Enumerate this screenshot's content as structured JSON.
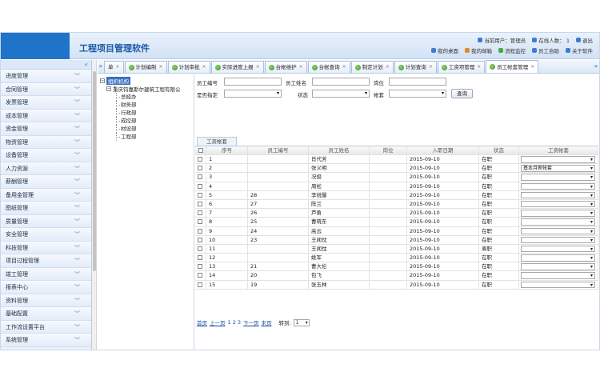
{
  "app": {
    "title": "工程项目管理软件"
  },
  "header": {
    "current_user_label": "当前用户：管理员",
    "online_label": "在线人数： 1",
    "logout": "退出",
    "links": [
      "我的桌面",
      "我的邮箱",
      "流程监控",
      "员工自助",
      "关于软件"
    ]
  },
  "sidebar": {
    "collapse_glyph": "«",
    "items": [
      "进度管理",
      "合同管理",
      "发票管理",
      "成本管理",
      "资金管理",
      "物资管理",
      "设备管理",
      "人力资源",
      "薪酬管理",
      "备用金管理",
      "图纸管理",
      "质量管理",
      "安全管理",
      "科技管理",
      "项目过程管理",
      "竣工管理",
      "报表中心",
      "资料管理",
      "基础配置",
      "工作流设置平台",
      "系统管理"
    ]
  },
  "tabs": {
    "prev_glyph": "«",
    "next_glyph": "»",
    "items": [
      {
        "label": "单"
      },
      {
        "label": "计划编制"
      },
      {
        "label": "计划审批"
      },
      {
        "label": "实际进度上报"
      },
      {
        "label": "台帐维护"
      },
      {
        "label": "台帐查询"
      },
      {
        "label": "制定计划"
      },
      {
        "label": "计划查询"
      },
      {
        "label": "工资项管理"
      },
      {
        "label": "员工帐套管理"
      }
    ],
    "active_index": 9,
    "close_glyph": "×"
  },
  "tree": {
    "root": "组织机构",
    "company": "重庆钧嘉斯尔建筑工程有限公",
    "departments": [
      "总经办",
      "财务部",
      "行政部",
      "成控部",
      "材设部",
      "工程部"
    ]
  },
  "filters": {
    "emp_no_label": "员工编号",
    "emp_name_label": "员工姓名",
    "position_label": "岗位",
    "assigned_label": "是否指定",
    "status_label": "状态",
    "account_label": "帐套",
    "query_button": "查询"
  },
  "subtab": "工资帐套",
  "table": {
    "headers": [
      "",
      "序号",
      "员工编号",
      "员工姓名",
      "岗位",
      "入职日期",
      "状态",
      "工资帐套"
    ],
    "rows": [
      {
        "seq": "1",
        "no": "",
        "name": "肖代芳",
        "pos": "",
        "date": "2015-09-10",
        "status": "在职",
        "account": ""
      },
      {
        "seq": "2",
        "no": "",
        "name": "张义明",
        "pos": "",
        "date": "2015-09-10",
        "status": "在职",
        "account": "基本月薪帐套"
      },
      {
        "seq": "3",
        "no": "",
        "name": "况俊",
        "pos": "",
        "date": "2015-09-10",
        "status": "在职",
        "account": ""
      },
      {
        "seq": "4",
        "no": "",
        "name": "周松",
        "pos": "",
        "date": "2015-09-10",
        "status": "在职",
        "account": ""
      },
      {
        "seq": "5",
        "no": "28",
        "name": "李锐馨",
        "pos": "",
        "date": "2015-09-10",
        "status": "在职",
        "account": ""
      },
      {
        "seq": "6",
        "no": "27",
        "name": "陈兰",
        "pos": "",
        "date": "2015-09-10",
        "status": "在职",
        "account": ""
      },
      {
        "seq": "7",
        "no": "26",
        "name": "芦勇",
        "pos": "",
        "date": "2015-09-10",
        "status": "在职",
        "account": ""
      },
      {
        "seq": "8",
        "no": "25",
        "name": "曹晓东",
        "pos": "",
        "date": "2015-09-10",
        "status": "在职",
        "account": ""
      },
      {
        "seq": "9",
        "no": "24",
        "name": "高云",
        "pos": "",
        "date": "2015-09-10",
        "status": "在职",
        "account": ""
      },
      {
        "seq": "10",
        "no": "23",
        "name": "王闻忱",
        "pos": "",
        "date": "2015-09-10",
        "status": "在职",
        "account": ""
      },
      {
        "seq": "11",
        "no": "",
        "name": "王闻忱",
        "pos": "",
        "date": "2015-09-10",
        "status": "离职",
        "account": ""
      },
      {
        "seq": "12",
        "no": "",
        "name": "姚军",
        "pos": "",
        "date": "2015-09-10",
        "status": "在职",
        "account": ""
      },
      {
        "seq": "13",
        "no": "21",
        "name": "曹大伦",
        "pos": "",
        "date": "2015-09-10",
        "status": "在职",
        "account": ""
      },
      {
        "seq": "14",
        "no": "20",
        "name": "包飞",
        "pos": "",
        "date": "2015-09-10",
        "status": "在职",
        "account": ""
      },
      {
        "seq": "15",
        "no": "19",
        "name": "张玉林",
        "pos": "",
        "date": "2015-09-10",
        "status": "在职",
        "account": ""
      }
    ]
  },
  "pager": {
    "first": "首页",
    "prev": "上一页",
    "pages": "1 2 3",
    "next": "下一页",
    "last": "末页",
    "goto_label": "转到:",
    "goto_value": "1"
  },
  "colors": {
    "accent": "#1f73c9",
    "title": "#1b5aa6",
    "sidebar_bg": "#eaf1fb"
  }
}
